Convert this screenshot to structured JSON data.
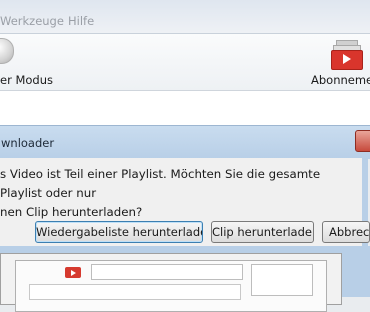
{
  "menubar": {
    "items": [
      "Werkzeuge",
      "Hilfe"
    ]
  },
  "toolbar": {
    "left_label": "er Modus",
    "right_label": "Abonnement"
  },
  "dialog": {
    "title": "wnloader",
    "message_line1": "s Video ist Teil einer Playlist. Möchten Sie die gesamte Playlist oder nur",
    "message_line2": "nen Clip herunterladen?",
    "buttons": {
      "playlist": "Wiedergabeliste herunterladen",
      "clip": "Clip herunterladen",
      "cancel": "Abbrech"
    }
  }
}
